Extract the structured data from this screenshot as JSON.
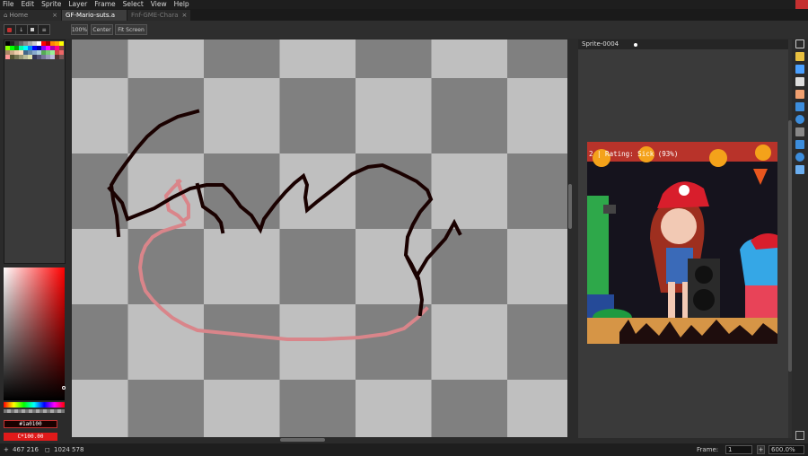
{
  "menu": [
    "File",
    "Edit",
    "Sprite",
    "Layer",
    "Frame",
    "Select",
    "View",
    "Help"
  ],
  "tabs": [
    {
      "label": "Home",
      "close": "×",
      "active": false
    },
    {
      "label": "GF-Mario-suts.a",
      "close": "×",
      "active": true
    },
    {
      "label": "Fnf-GME-Chara",
      "close": "×",
      "active": false
    }
  ],
  "toolbar": {
    "zoom_100": "100%",
    "center": "Center",
    "fit_screen": "Fit Screen"
  },
  "color_fields": {
    "foreground": "#1a0100",
    "background": "C*100.00"
  },
  "preview": {
    "title": "Sprite-0004",
    "overlay_text": "2 | Rating: Sick (93%)"
  },
  "status": {
    "cursor_pos": "467 216",
    "sprite_size": "1024 578",
    "frame_label": "Frame:",
    "frame_value": "1",
    "zoom": "600.0%"
  },
  "colors": {
    "accent": "#c43030",
    "canvas_light": "#bfbfbf",
    "canvas_dark": "#808080",
    "stroke_dark": "#1a0100",
    "stroke_pink": "#d9858a"
  },
  "icons": [
    "record-icon",
    "onion-skin-icon",
    "loop-icon",
    "layers-icon",
    "marquee-tool-icon",
    "pencil-tool-icon",
    "eraser-tool-icon",
    "eyedropper-tool-icon",
    "hand-tool-icon",
    "move-tool-icon",
    "fill-tool-icon",
    "line-tool-icon",
    "rectangle-tool-icon",
    "ellipse-tool-icon",
    "blur-tool-icon"
  ]
}
